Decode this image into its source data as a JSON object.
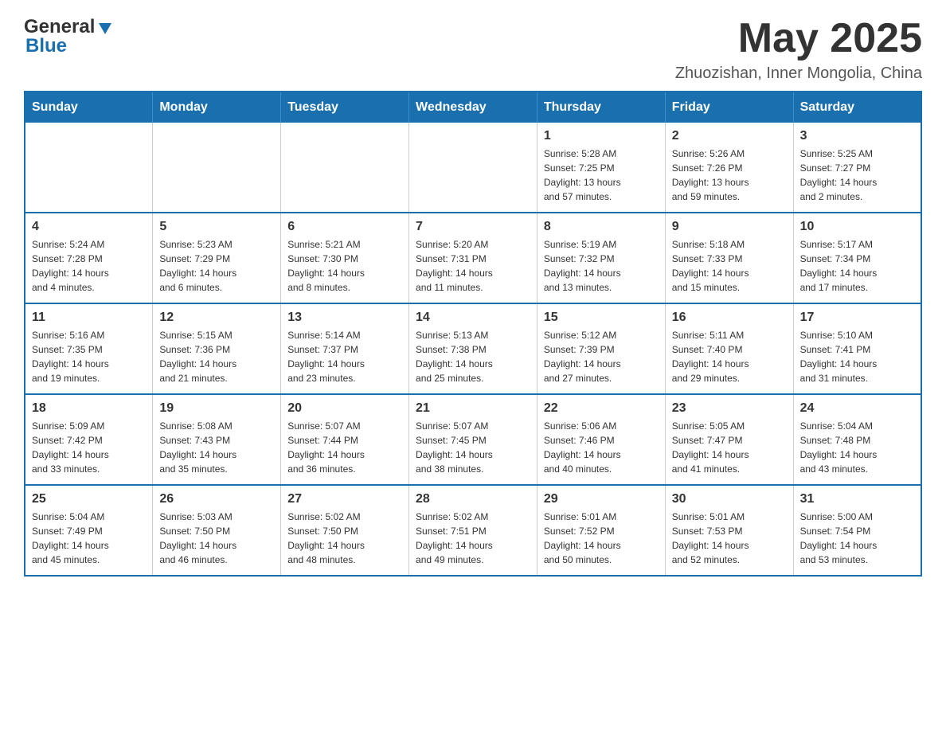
{
  "header": {
    "logo_general": "General",
    "logo_blue": "Blue",
    "month_title": "May 2025",
    "location": "Zhuozishan, Inner Mongolia, China"
  },
  "days_of_week": [
    "Sunday",
    "Monday",
    "Tuesday",
    "Wednesday",
    "Thursday",
    "Friday",
    "Saturday"
  ],
  "weeks": [
    [
      {
        "day": "",
        "info": ""
      },
      {
        "day": "",
        "info": ""
      },
      {
        "day": "",
        "info": ""
      },
      {
        "day": "",
        "info": ""
      },
      {
        "day": "1",
        "info": "Sunrise: 5:28 AM\nSunset: 7:25 PM\nDaylight: 13 hours\nand 57 minutes."
      },
      {
        "day": "2",
        "info": "Sunrise: 5:26 AM\nSunset: 7:26 PM\nDaylight: 13 hours\nand 59 minutes."
      },
      {
        "day": "3",
        "info": "Sunrise: 5:25 AM\nSunset: 7:27 PM\nDaylight: 14 hours\nand 2 minutes."
      }
    ],
    [
      {
        "day": "4",
        "info": "Sunrise: 5:24 AM\nSunset: 7:28 PM\nDaylight: 14 hours\nand 4 minutes."
      },
      {
        "day": "5",
        "info": "Sunrise: 5:23 AM\nSunset: 7:29 PM\nDaylight: 14 hours\nand 6 minutes."
      },
      {
        "day": "6",
        "info": "Sunrise: 5:21 AM\nSunset: 7:30 PM\nDaylight: 14 hours\nand 8 minutes."
      },
      {
        "day": "7",
        "info": "Sunrise: 5:20 AM\nSunset: 7:31 PM\nDaylight: 14 hours\nand 11 minutes."
      },
      {
        "day": "8",
        "info": "Sunrise: 5:19 AM\nSunset: 7:32 PM\nDaylight: 14 hours\nand 13 minutes."
      },
      {
        "day": "9",
        "info": "Sunrise: 5:18 AM\nSunset: 7:33 PM\nDaylight: 14 hours\nand 15 minutes."
      },
      {
        "day": "10",
        "info": "Sunrise: 5:17 AM\nSunset: 7:34 PM\nDaylight: 14 hours\nand 17 minutes."
      }
    ],
    [
      {
        "day": "11",
        "info": "Sunrise: 5:16 AM\nSunset: 7:35 PM\nDaylight: 14 hours\nand 19 minutes."
      },
      {
        "day": "12",
        "info": "Sunrise: 5:15 AM\nSunset: 7:36 PM\nDaylight: 14 hours\nand 21 minutes."
      },
      {
        "day": "13",
        "info": "Sunrise: 5:14 AM\nSunset: 7:37 PM\nDaylight: 14 hours\nand 23 minutes."
      },
      {
        "day": "14",
        "info": "Sunrise: 5:13 AM\nSunset: 7:38 PM\nDaylight: 14 hours\nand 25 minutes."
      },
      {
        "day": "15",
        "info": "Sunrise: 5:12 AM\nSunset: 7:39 PM\nDaylight: 14 hours\nand 27 minutes."
      },
      {
        "day": "16",
        "info": "Sunrise: 5:11 AM\nSunset: 7:40 PM\nDaylight: 14 hours\nand 29 minutes."
      },
      {
        "day": "17",
        "info": "Sunrise: 5:10 AM\nSunset: 7:41 PM\nDaylight: 14 hours\nand 31 minutes."
      }
    ],
    [
      {
        "day": "18",
        "info": "Sunrise: 5:09 AM\nSunset: 7:42 PM\nDaylight: 14 hours\nand 33 minutes."
      },
      {
        "day": "19",
        "info": "Sunrise: 5:08 AM\nSunset: 7:43 PM\nDaylight: 14 hours\nand 35 minutes."
      },
      {
        "day": "20",
        "info": "Sunrise: 5:07 AM\nSunset: 7:44 PM\nDaylight: 14 hours\nand 36 minutes."
      },
      {
        "day": "21",
        "info": "Sunrise: 5:07 AM\nSunset: 7:45 PM\nDaylight: 14 hours\nand 38 minutes."
      },
      {
        "day": "22",
        "info": "Sunrise: 5:06 AM\nSunset: 7:46 PM\nDaylight: 14 hours\nand 40 minutes."
      },
      {
        "day": "23",
        "info": "Sunrise: 5:05 AM\nSunset: 7:47 PM\nDaylight: 14 hours\nand 41 minutes."
      },
      {
        "day": "24",
        "info": "Sunrise: 5:04 AM\nSunset: 7:48 PM\nDaylight: 14 hours\nand 43 minutes."
      }
    ],
    [
      {
        "day": "25",
        "info": "Sunrise: 5:04 AM\nSunset: 7:49 PM\nDaylight: 14 hours\nand 45 minutes."
      },
      {
        "day": "26",
        "info": "Sunrise: 5:03 AM\nSunset: 7:50 PM\nDaylight: 14 hours\nand 46 minutes."
      },
      {
        "day": "27",
        "info": "Sunrise: 5:02 AM\nSunset: 7:50 PM\nDaylight: 14 hours\nand 48 minutes."
      },
      {
        "day": "28",
        "info": "Sunrise: 5:02 AM\nSunset: 7:51 PM\nDaylight: 14 hours\nand 49 minutes."
      },
      {
        "day": "29",
        "info": "Sunrise: 5:01 AM\nSunset: 7:52 PM\nDaylight: 14 hours\nand 50 minutes."
      },
      {
        "day": "30",
        "info": "Sunrise: 5:01 AM\nSunset: 7:53 PM\nDaylight: 14 hours\nand 52 minutes."
      },
      {
        "day": "31",
        "info": "Sunrise: 5:00 AM\nSunset: 7:54 PM\nDaylight: 14 hours\nand 53 minutes."
      }
    ]
  ],
  "colors": {
    "header_bg": "#1a6faf",
    "header_text": "#ffffff",
    "border": "#1a6faf",
    "accent": "#1a6faf"
  }
}
